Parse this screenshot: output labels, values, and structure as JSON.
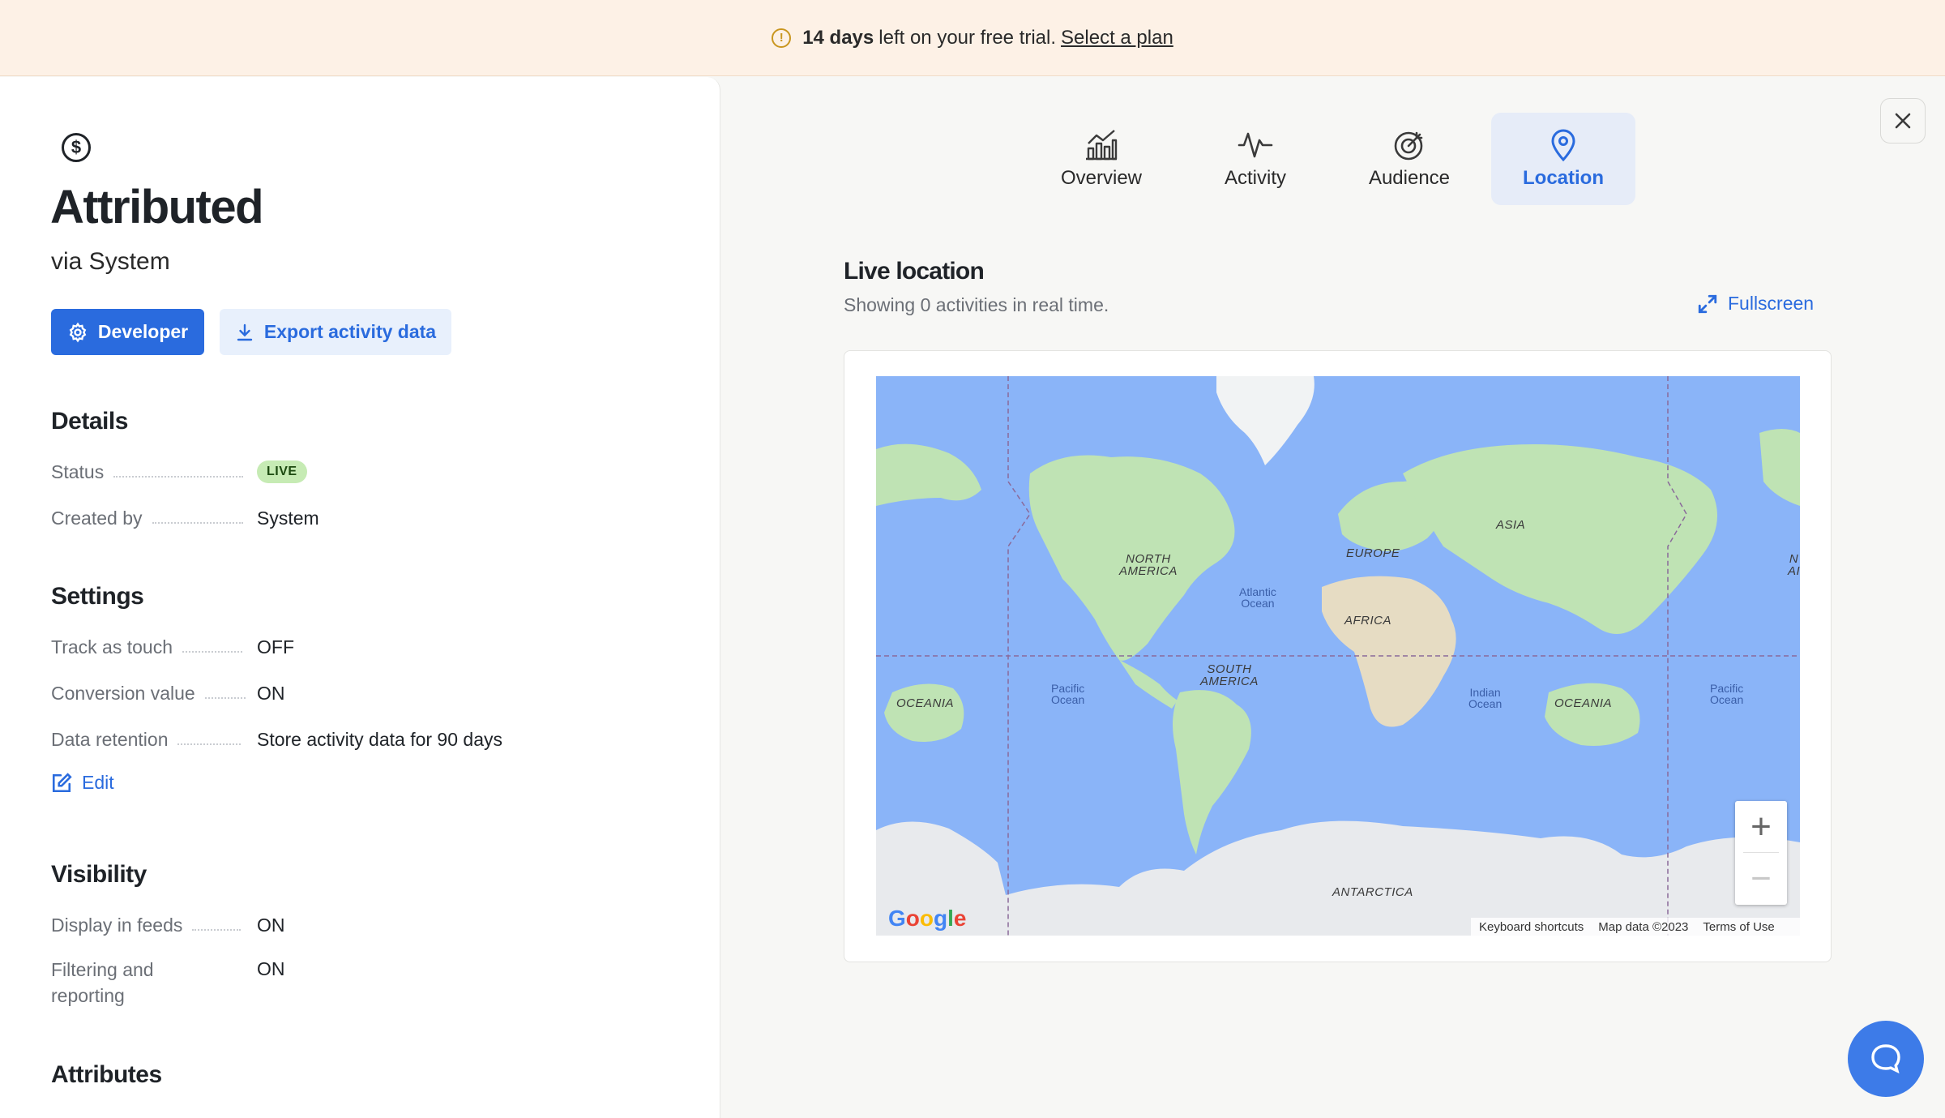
{
  "banner": {
    "days": "14 days",
    "text": "left on your free trial.",
    "link": "Select a plan"
  },
  "panel": {
    "title": "Attributed",
    "subtitle": "via System",
    "developer_button": "Developer",
    "export_button": "Export activity data",
    "details": {
      "heading": "Details",
      "status_label": "Status",
      "status_value": "LIVE",
      "created_by_label": "Created by",
      "created_by_value": "System"
    },
    "settings": {
      "heading": "Settings",
      "rows": [
        {
          "label": "Track as touch",
          "value": "OFF"
        },
        {
          "label": "Conversion value",
          "value": "ON"
        },
        {
          "label": "Data retention",
          "value": "Store activity data for 90 days"
        }
      ],
      "edit_label": "Edit"
    },
    "visibility": {
      "heading": "Visibility",
      "display_label": "Display in feeds",
      "display_value": "ON",
      "filtering_label_1": "Filtering and",
      "filtering_label_2": "reporting",
      "filtering_value": "ON"
    },
    "attributes_heading": "Attributes"
  },
  "tabs": [
    {
      "label": "Overview",
      "icon": "bar-chart-icon"
    },
    {
      "label": "Activity",
      "icon": "pulse-icon"
    },
    {
      "label": "Audience",
      "icon": "target-icon"
    },
    {
      "label": "Location",
      "icon": "map-pin-icon",
      "active": true
    }
  ],
  "live": {
    "title": "Live location",
    "subtitle": "Showing 0 activities in real time.",
    "fullscreen": "Fullscreen"
  },
  "map": {
    "labels": {
      "north_america_1": "NORTH",
      "north_america_2": "AMERICA",
      "south_america_1": "SOUTH",
      "south_america_2": "AMERICA",
      "europe": "EUROPE",
      "asia": "ASIA",
      "africa": "AFRICA",
      "oceania_left": "OCEANIA",
      "oceania_right": "OCEANIA",
      "antarctica": "ANTARCTICA",
      "atlantic_1": "Atlantic",
      "atlantic_2": "Ocean",
      "pacific_left_1": "Pacific",
      "pacific_left_2": "Ocean",
      "pacific_right_1": "Pacific",
      "pacific_right_2": "Ocean",
      "indian_1": "Indian",
      "indian_2": "Ocean",
      "na_edge_1": "N",
      "na_edge_2": "AI"
    },
    "google": "Google",
    "keyboard": "Keyboard shortcuts",
    "map_data": "Map data ©2023",
    "terms": "Terms of Use"
  },
  "colors": {
    "accent": "#2a6bde",
    "ocean": "#8ab4f8",
    "land": "#bfe3b4",
    "ice": "#e8eaed",
    "banner_bg": "#fdf1e6"
  }
}
